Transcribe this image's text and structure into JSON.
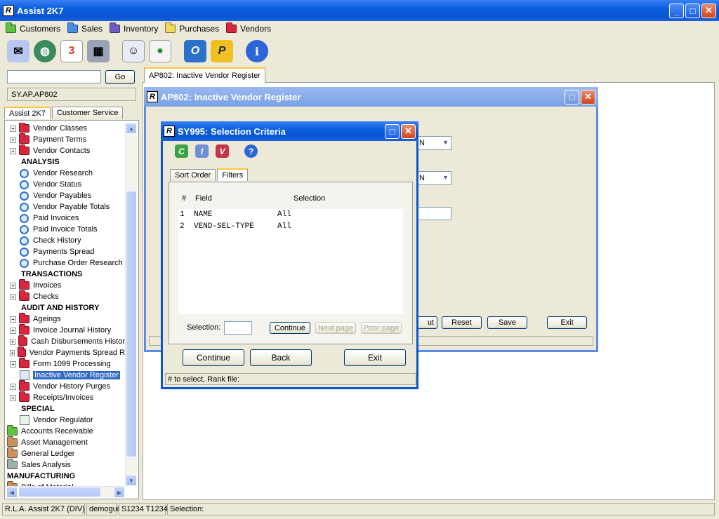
{
  "window": {
    "title": "Assist 2K7"
  },
  "menu": [
    {
      "label": "Customers",
      "color": "fg"
    },
    {
      "label": "Sales",
      "color": "fb"
    },
    {
      "label": "Inventory",
      "color": "fp"
    },
    {
      "label": "Purchases",
      "color": "fy"
    },
    {
      "label": "Vendors",
      "color": "fr"
    }
  ],
  "search": {
    "go": "Go",
    "code": "SY.AP.AP802"
  },
  "tabs": {
    "assist": "Assist 2K7",
    "service": "Customer Service",
    "doc": "AP802: Inactive Vendor Register"
  },
  "tree": [
    {
      "label": "Vendor Classes",
      "kind": "folder"
    },
    {
      "label": "Payment Terms",
      "kind": "folder"
    },
    {
      "label": "Vendor Contacts",
      "kind": "folder"
    },
    {
      "label": "ANALYSIS",
      "kind": "header"
    },
    {
      "label": "Vendor Research",
      "kind": "mag"
    },
    {
      "label": "Vendor Status",
      "kind": "mag"
    },
    {
      "label": "Vendor Payables",
      "kind": "mag"
    },
    {
      "label": "Vendor Payable Totals",
      "kind": "mag"
    },
    {
      "label": "Paid Invoices",
      "kind": "mag"
    },
    {
      "label": "Paid Invoice Totals",
      "kind": "mag"
    },
    {
      "label": "Check History",
      "kind": "mag"
    },
    {
      "label": "Payments Spread",
      "kind": "mag"
    },
    {
      "label": "Purchase Order Research",
      "kind": "mag"
    },
    {
      "label": "TRANSACTIONS",
      "kind": "header"
    },
    {
      "label": "Invoices",
      "kind": "folder"
    },
    {
      "label": "Checks",
      "kind": "folder"
    },
    {
      "label": "AUDIT AND HISTORY",
      "kind": "header"
    },
    {
      "label": "Ageings",
      "kind": "folder"
    },
    {
      "label": "Invoice Journal History",
      "kind": "folder"
    },
    {
      "label": "Cash Disbursements Histor",
      "kind": "folder"
    },
    {
      "label": "Vendor Payments Spread R",
      "kind": "folder"
    },
    {
      "label": "Form 1099 Processing",
      "kind": "folder"
    },
    {
      "label": "Inactive Vendor Register",
      "kind": "report"
    },
    {
      "label": "Vendor History Purges",
      "kind": "folder"
    },
    {
      "label": "Receipts/Invoices",
      "kind": "folder"
    },
    {
      "label": "SPECIAL",
      "kind": "header"
    },
    {
      "label": "Vendor Regulator",
      "kind": "report2"
    },
    {
      "label": "Accounts Receivable",
      "kind": "root",
      "color": "fg"
    },
    {
      "label": "Asset Management",
      "kind": "root",
      "color": "fw"
    },
    {
      "label": "General Ledger",
      "kind": "root",
      "color": "fw"
    },
    {
      "label": "Sales Analysis",
      "kind": "root",
      "color": "fgr"
    },
    {
      "label": "MANUFACTURING",
      "kind": "roothdr"
    },
    {
      "label": "Bills of Material",
      "kind": "root",
      "color": "fw"
    }
  ],
  "ap802": {
    "title": "AP802: Inactive Vendor Register",
    "field1": "N",
    "field2": "N",
    "buttons": {
      "out": "ut",
      "reset": "Reset",
      "save": "Save",
      "exit": "Exit"
    }
  },
  "sy995": {
    "title": "SY995: Selection Criteria",
    "tab_sort": "Sort Order",
    "tab_filters": "Filters",
    "col_num": "#",
    "col_field": "Field",
    "col_sel": "Selection",
    "rows": [
      {
        "n": "1",
        "field": "NAME",
        "sel": "All"
      },
      {
        "n": "2",
        "field": "VEND-SEL-TYPE",
        "sel": "All"
      }
    ],
    "selection_label": "Selection:",
    "selection_value": "",
    "continue_small": "Continue",
    "next_page": "Next page",
    "prior_page": "Prior page",
    "continue": "Continue",
    "back": "Back",
    "exit": "Exit",
    "status": "# to select,  Rank file:"
  },
  "status": {
    "app": "R.L.A. Assist 2K7 (DIV)",
    "user": "demogui",
    "term": "S1234 T1234",
    "sel": "Selection:"
  }
}
